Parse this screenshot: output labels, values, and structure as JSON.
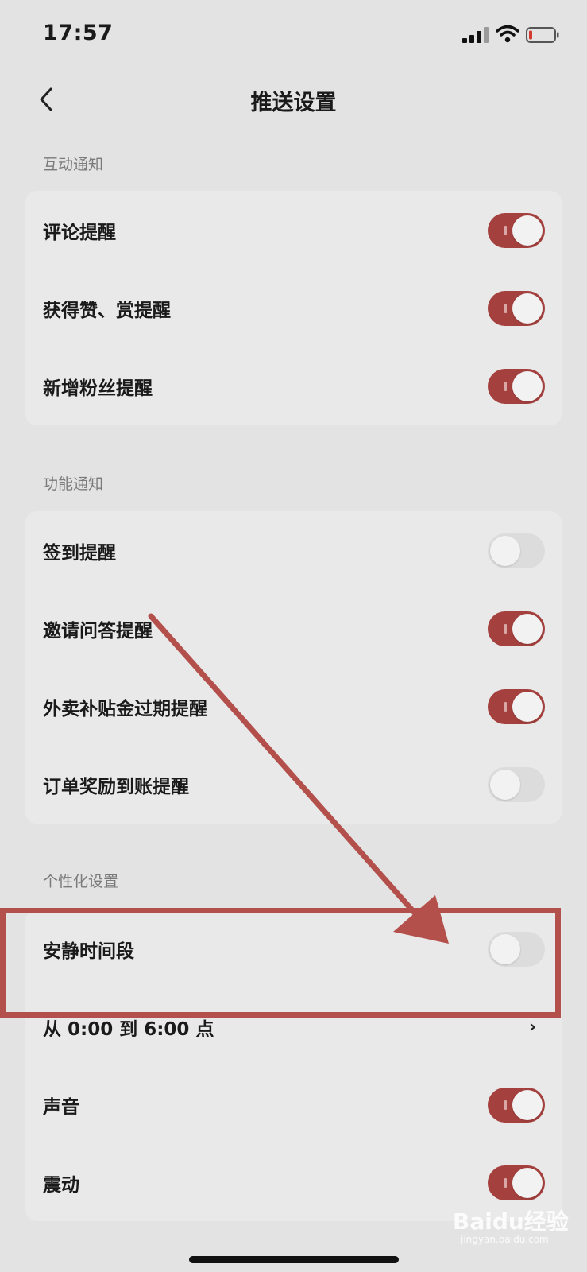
{
  "status_bar": {
    "time": "17:57"
  },
  "nav": {
    "title": "推送设置"
  },
  "sections": [
    {
      "header": "互动通知",
      "rows": [
        {
          "label": "评论提醒",
          "toggle": true
        },
        {
          "label": "获得赞、赏提醒",
          "toggle": true
        },
        {
          "label": "新增粉丝提醒",
          "toggle": true
        }
      ]
    },
    {
      "header": "功能通知",
      "rows": [
        {
          "label": "签到提醒",
          "toggle": false
        },
        {
          "label": "邀请问答提醒",
          "toggle": true
        },
        {
          "label": "外卖补贴金过期提醒",
          "toggle": true
        },
        {
          "label": "订单奖励到账提醒",
          "toggle": false
        }
      ]
    },
    {
      "header": "个性化设置",
      "rows": [
        {
          "label": "安静时间段",
          "toggle": false
        },
        {
          "label": "从 0:00 到 6:00 点",
          "chevron": "›"
        },
        {
          "label": "声音",
          "toggle": true
        },
        {
          "label": "震动",
          "toggle": true
        }
      ]
    }
  ],
  "colors": {
    "toggle_on": "#a4403e",
    "toggle_off": "#dcdcdc",
    "annotation": "#b3504c"
  },
  "watermark": {
    "text": "Baidu经验",
    "sub": "jingyan.baidu.com"
  }
}
